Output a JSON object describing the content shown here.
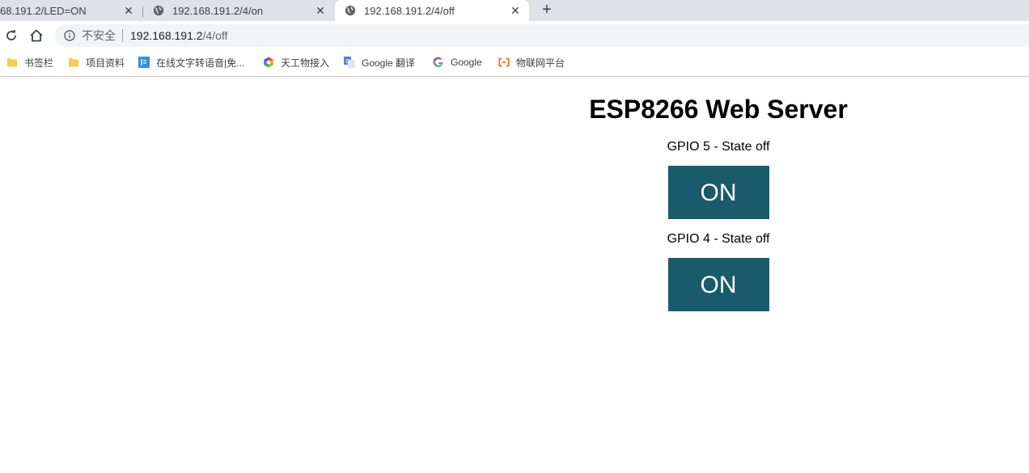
{
  "tabs": [
    {
      "title": "68.191.2/LED=ON",
      "active": false
    },
    {
      "title": "192.168.191.2/4/on",
      "active": false
    },
    {
      "title": "192.168.191.2/4/off",
      "active": true
    }
  ],
  "address_bar": {
    "security_label": "不安全",
    "host": "192.168.191.2",
    "path": "/4/off"
  },
  "bookmarks": [
    {
      "label": "书签栏",
      "icon": "folder-icon"
    },
    {
      "label": "项目资料",
      "icon": "folder-icon"
    },
    {
      "label": "在线文字转语音|免...",
      "icon": "tts-site-icon"
    },
    {
      "label": "天工物接入",
      "icon": "tiangong-icon"
    },
    {
      "label": "Google 翻译",
      "icon": "google-translate-icon"
    },
    {
      "label": "Google",
      "icon": "google-icon"
    },
    {
      "label": "物联网平台",
      "icon": "aliyun-iot-icon"
    }
  ],
  "page": {
    "heading": "ESP8266 Web Server",
    "gpios": [
      {
        "label": "GPIO 5 - State off",
        "button_label": "ON"
      },
      {
        "label": "GPIO 4 - State off",
        "button_label": "ON"
      }
    ]
  },
  "colors": {
    "button_bg": "#195b6a",
    "button_text": "#ffffff",
    "tabstrip_bg": "#dee1e6"
  }
}
